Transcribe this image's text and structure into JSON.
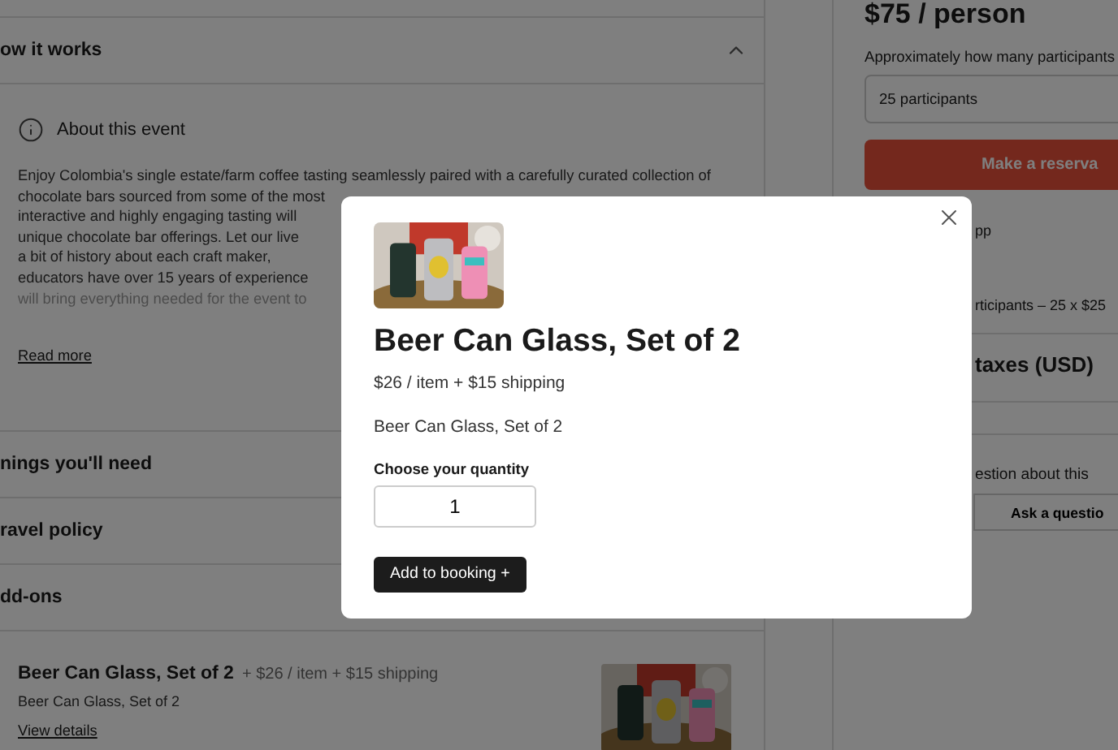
{
  "page": {
    "accordion": {
      "title": "ow it works",
      "expanded": true
    },
    "about": {
      "title": "About this event",
      "lines": [
        "Enjoy Colombia's single estate/farm coffee tasting seamlessly paired with a carefully curated collection of",
        "chocolate bars sourced from some of the most",
        "interactive and highly engaging tasting will",
        "unique chocolate bar offerings. Let our live",
        "a bit of history about each craft maker,",
        "educators have over 15 years of experience",
        "will bring everything needed for the event to"
      ],
      "read_more": "Read more"
    },
    "sections": [
      "nings you'll need",
      "ravel policy",
      "dd-ons"
    ],
    "addon": {
      "title": "Beer Can Glass, Set of 2",
      "price": "+ $26 / item + $15 shipping",
      "description": "Beer Can Glass, Set of 2",
      "link": "View details"
    }
  },
  "sidebar": {
    "price": "$75 / person",
    "participants_label": "Approximately how many participants",
    "participants_value": "25 participants",
    "reserve_button": "Make a reserva",
    "per_person": "pp",
    "breakdown": "rticipants – 25 x $25",
    "total": "taxes (USD)",
    "question": "estion about this",
    "ask_button": "Ask a questio"
  },
  "modal": {
    "title": "Beer Can Glass, Set of 2",
    "price": "$26 / item + $15 shipping",
    "description": "Beer Can Glass, Set of 2",
    "quantity_label": "Choose your quantity",
    "quantity": "1",
    "add_button": "Add to booking +"
  }
}
